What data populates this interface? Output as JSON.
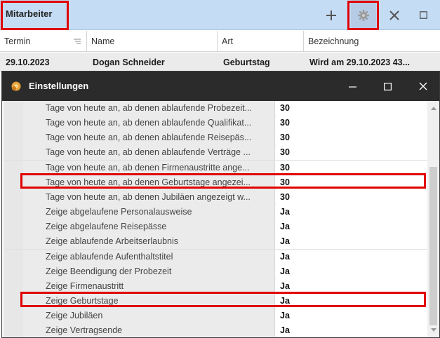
{
  "panel": {
    "title": "Mitarbeiter",
    "toolbar": {
      "add_icon": "plus-icon",
      "settings_icon": "gear-icon",
      "close_icon": "close-icon",
      "restore_icon": "square-icon"
    }
  },
  "grid": {
    "columns": [
      "Termin",
      "Name",
      "Art",
      "Bezeichnung"
    ],
    "rows": [
      {
        "termin": "29.10.2023",
        "name": "Dogan Schneider",
        "art": "Geburtstag",
        "bezeichnung": "Wird am 29.10.2023 43..."
      }
    ]
  },
  "dialog": {
    "title": "Einstellungen",
    "icon": "settings-app-icon",
    "rows": [
      {
        "name": "Tage von heute an, ab denen ablaufende Probezeit...",
        "value": "30"
      },
      {
        "name": "Tage von heute an, ab denen ablaufende Qualifikat...",
        "value": "30"
      },
      {
        "name": "Tage von heute an, ab denen ablaufende Reisepäs...",
        "value": "30"
      },
      {
        "name": "Tage von heute an, ab denen ablaufende Verträge ...",
        "value": "30"
      },
      {
        "name": "Tage von heute an, ab denen Firmenaustritte ange...",
        "value": "30"
      },
      {
        "name": "Tage von heute an, ab denen Geburtstage angezei...",
        "value": "30"
      },
      {
        "name": "Tage von heute an, ab denen Jubiläen angezeigt w...",
        "value": "30"
      },
      {
        "name": "Zeige abgelaufene Personalausweise",
        "value": "Ja"
      },
      {
        "name": "Zeige abgelaufene Reisepässe",
        "value": "Ja"
      },
      {
        "name": "Zeige ablaufende Arbeitserlaubnis",
        "value": "Ja"
      },
      {
        "name": "Zeige ablaufende Aufenthaltstitel",
        "value": "Ja"
      },
      {
        "name": "Zeige Beendigung der Probezeit",
        "value": "Ja"
      },
      {
        "name": "Zeige Firmenaustritt",
        "value": "Ja"
      },
      {
        "name": "Zeige Geburtstage",
        "value": "Ja"
      },
      {
        "name": "Zeige Jubiläen",
        "value": "Ja"
      },
      {
        "name": "Zeige Vertragsende",
        "value": "Ja"
      }
    ]
  },
  "colors": {
    "highlight": "#e00000",
    "header_bg": "#c5dcf5",
    "dialog_title_bg": "#2b2b2b"
  }
}
